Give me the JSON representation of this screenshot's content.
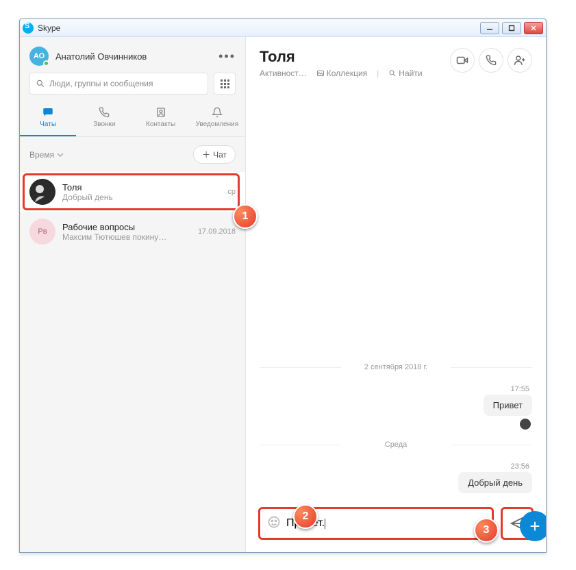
{
  "window": {
    "title": "Skype"
  },
  "profile": {
    "initials": "АО",
    "name": "Анатолий Овчинников"
  },
  "search": {
    "placeholder": "Люди, группы и сообщения"
  },
  "nav": {
    "chats": "Чаты",
    "calls": "Звонки",
    "contacts": "Контакты",
    "notifications": "Уведомления"
  },
  "sort": {
    "label": "Время"
  },
  "new_chat_btn": "Чат",
  "chat_list": [
    {
      "name": "Толя",
      "preview": "Добрый день",
      "time": "ср",
      "initials": ""
    },
    {
      "name": "Рабочие вопросы",
      "preview": "Максим Тютюшев покину…",
      "time": "17.09.2018",
      "initials": "Рв"
    }
  ],
  "conversation": {
    "title": "Толя",
    "subtabs": {
      "activity": "Активност…",
      "collection": "Коллекция",
      "find": "Найти"
    },
    "dates": {
      "d1": "2 сентября 2018 г.",
      "d2": "Среда"
    },
    "msgs": [
      {
        "time": "17:55",
        "text": "Привет"
      },
      {
        "time": "23:56",
        "text": "Добрый день"
      }
    ],
    "composer_value": "Привет."
  },
  "callouts": {
    "c1": "1",
    "c2": "2",
    "c3": "3"
  }
}
